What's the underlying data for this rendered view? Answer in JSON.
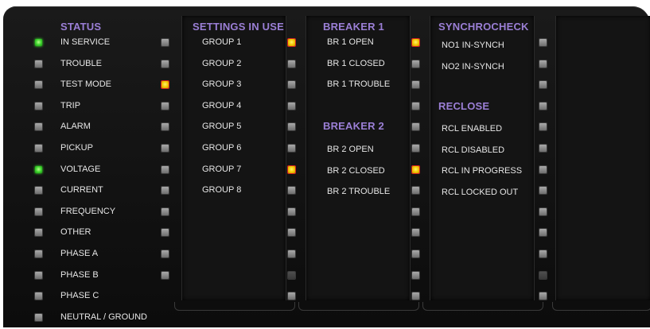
{
  "status": {
    "header": "STATUS",
    "items": [
      {
        "label": "IN SERVICE",
        "led": "green"
      },
      {
        "label": "TROUBLE",
        "led": "off"
      },
      {
        "label": "TEST MODE",
        "led": "off"
      },
      {
        "label": "TRIP",
        "led": "off"
      },
      {
        "label": "ALARM",
        "led": "off"
      },
      {
        "label": "PICKUP",
        "led": "off"
      },
      {
        "label": "VOLTAGE",
        "led": "green"
      },
      {
        "label": "CURRENT",
        "led": "off"
      },
      {
        "label": "FREQUENCY",
        "led": "off"
      },
      {
        "label": "OTHER",
        "led": "off"
      },
      {
        "label": "PHASE A",
        "led": "off"
      },
      {
        "label": "PHASE B",
        "led": "off"
      },
      {
        "label": "PHASE C",
        "led": "off"
      },
      {
        "label": "NEUTRAL / GROUND",
        "led": "off"
      }
    ]
  },
  "settings": {
    "header": "SETTINGS IN USE",
    "items": [
      "GROUP 1",
      "GROUP 2",
      "GROUP 3",
      "GROUP 4",
      "GROUP 5",
      "GROUP 6",
      "GROUP 7",
      "GROUP 8"
    ],
    "leds": [
      "off",
      "off",
      "yellow",
      "off",
      "off",
      "off",
      "off",
      "off",
      "off",
      "off",
      "off",
      "off"
    ]
  },
  "breaker1": {
    "header": "BREAKER 1",
    "items": [
      "BR 1 OPEN",
      "BR 1 CLOSED",
      "BR 1 TROUBLE"
    ],
    "leds": [
      "yellow",
      "off",
      "off",
      "off",
      "off",
      "off",
      "yellow",
      "off",
      "off",
      "off",
      "off",
      "dim",
      "off"
    ]
  },
  "breaker2": {
    "header": "BREAKER 2",
    "items": [
      "BR 2 OPEN",
      "BR 2 CLOSED",
      "BR 2 TROUBLE"
    ]
  },
  "synchrocheck": {
    "header": "SYNCHROCHECK",
    "items": [
      "NO1 IN-SYNCH",
      "NO2 IN-SYNCH"
    ],
    "leds": [
      "yellow",
      "off",
      "off",
      "off",
      "off",
      "off",
      "yellow",
      "off",
      "off",
      "off",
      "off",
      "off",
      "off"
    ]
  },
  "reclose": {
    "header": "RECLOSE",
    "items": [
      "RCL ENABLED",
      "RCL DISABLED",
      "RCL IN PROGRESS",
      "RCL LOCKED OUT"
    ]
  },
  "extra": {
    "leds": [
      "off",
      "off",
      "off",
      "off",
      "off",
      "off",
      "off",
      "off",
      "off",
      "off",
      "off",
      "dim",
      "off"
    ]
  },
  "colors": {
    "header": "#9b7fd6",
    "led_green": "#39d02a",
    "led_yellow": "#f2c400",
    "led_off": "#8c8c8c"
  }
}
